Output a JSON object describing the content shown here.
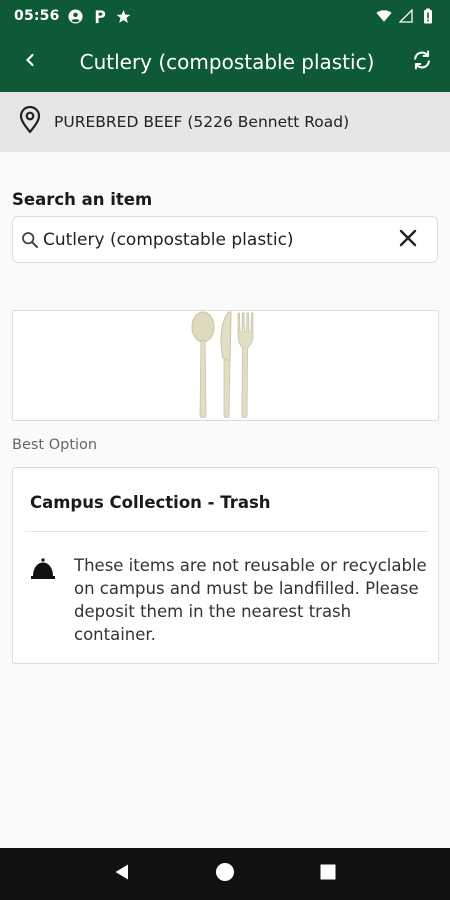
{
  "status_bar": {
    "time": "05:56",
    "icons": [
      "account-circle-icon",
      "parking-icon",
      "star-icon"
    ],
    "right_icons": [
      "wifi-icon",
      "cell-signal-icon",
      "battery-icon"
    ]
  },
  "app_bar": {
    "title": "Cutlery (compostable plastic)",
    "back_icon": "chevron-left-icon",
    "refresh_icon": "refresh-icon"
  },
  "location": {
    "icon": "location-pin-icon",
    "text": "PUREBRED BEEF (5226 Bennett Road)"
  },
  "search": {
    "label": "Search an item",
    "value": "Cutlery (compostable plastic)",
    "icon": "search-icon",
    "clear_icon": "close-icon"
  },
  "item_image": {
    "description_icon": "cutlery-image"
  },
  "best_option": {
    "label": "Best Option",
    "title": "Campus Collection - Trash",
    "icon": "service-bell-icon",
    "description": "These items are not reusable or recyclable on campus and must be landfilled.  Please deposit them in the nearest trash container."
  },
  "nav_bar": {
    "buttons": [
      "back-triangle-icon",
      "home-circle-icon",
      "recents-square-icon"
    ]
  },
  "colors": {
    "primary": "#0e5a36",
    "location_bg": "#e6e6e6",
    "page_bg": "#fafafa"
  }
}
